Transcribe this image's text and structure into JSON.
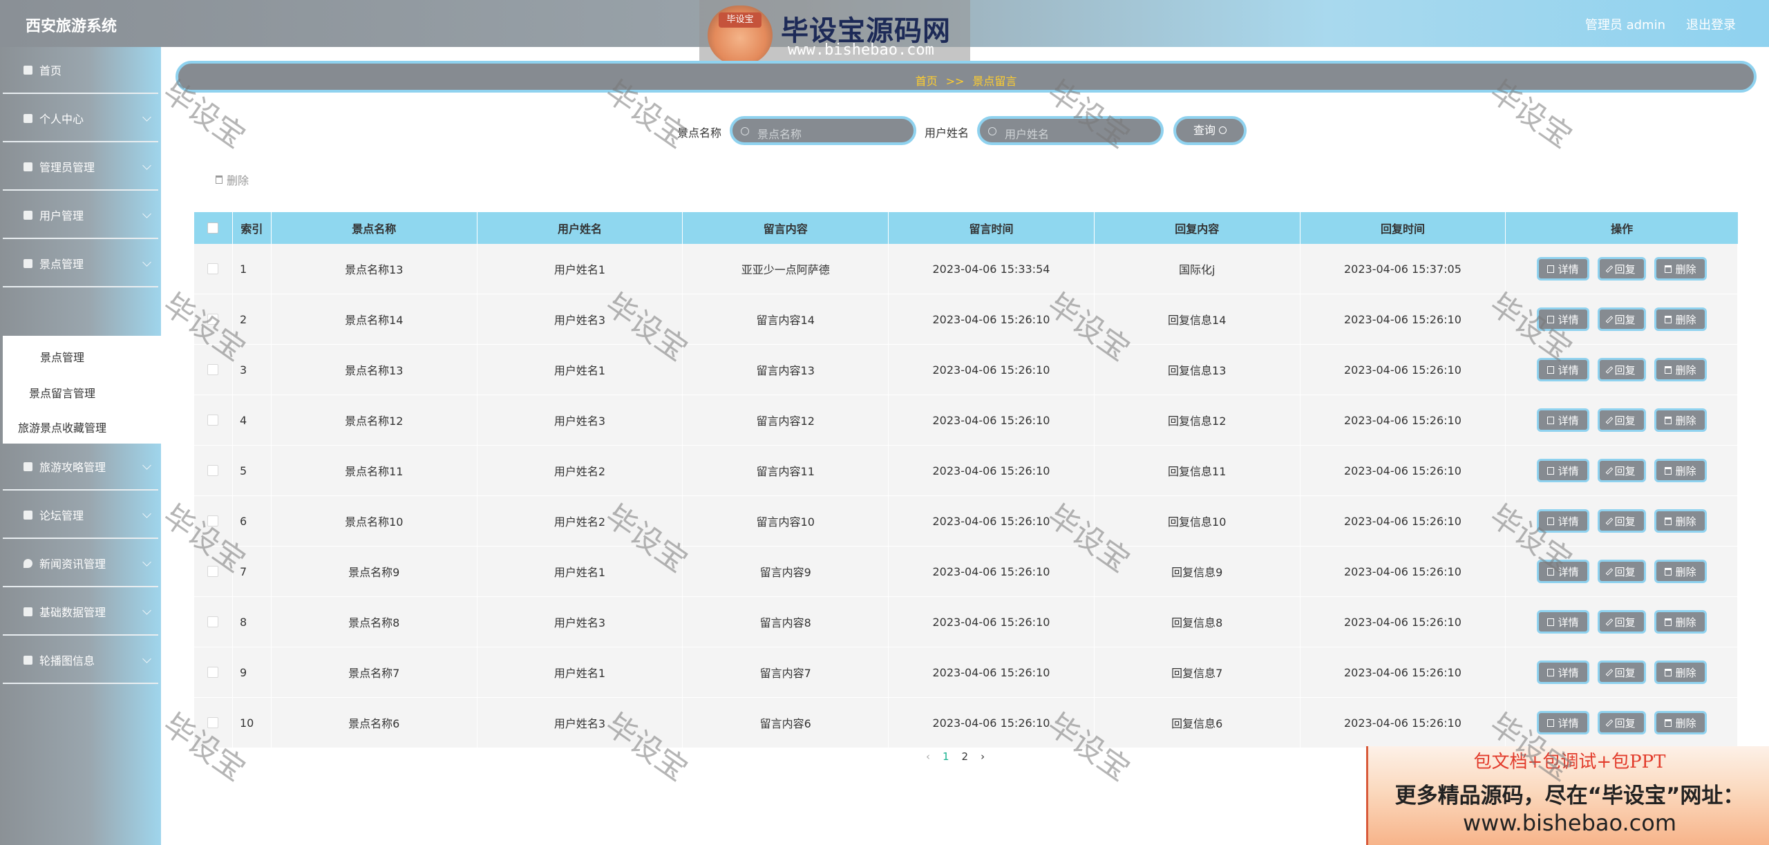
{
  "app": {
    "title": "西安旅游系统"
  },
  "header": {
    "user": "管理员 admin",
    "logout": "退出登录"
  },
  "logo": {
    "badge": "毕设宝",
    "name": "毕设宝源码网",
    "url": "www.bishebao.com"
  },
  "sidebar": {
    "items": [
      {
        "label": "首页",
        "icon": "home-icon"
      },
      {
        "label": "个人中心",
        "icon": "user-icon"
      },
      {
        "label": "管理员管理",
        "icon": "grid-icon"
      },
      {
        "label": "用户管理",
        "icon": "chat-icon"
      },
      {
        "label": "景点管理",
        "icon": "book-icon"
      },
      {
        "label": "旅游攻略管理",
        "icon": "grid-icon"
      },
      {
        "label": "论坛管理",
        "icon": "clipboard-icon"
      },
      {
        "label": "新闻资讯管理",
        "icon": "pin-icon"
      },
      {
        "label": "基础数据管理",
        "icon": "grid-icon"
      },
      {
        "label": "轮播图信息",
        "icon": "cup-icon"
      }
    ],
    "submenu": [
      "景点管理",
      "景点留言管理",
      "旅游景点收藏管理"
    ]
  },
  "breadcrumb": {
    "home": "首页",
    "sep": ">>",
    "current": "景点留言"
  },
  "search": {
    "field1_label": "景点名称",
    "field1_placeholder": "景点名称",
    "field2_label": "用户姓名",
    "field2_placeholder": "用户姓名",
    "button": "查询"
  },
  "toolbar": {
    "delete": "删除"
  },
  "table": {
    "headers": [
      "索引",
      "景点名称",
      "用户姓名",
      "留言内容",
      "留言时间",
      "回复内容",
      "回复时间",
      "操作"
    ],
    "actions": {
      "detail": "详情",
      "reply": "回复",
      "delete": "删除"
    },
    "rows": [
      {
        "index": "1",
        "spot": "景点名称13",
        "user": "用户姓名1",
        "content": "亚亚少一点阿萨德",
        "time": "2023-04-06 15:33:54",
        "reply": "国际化j",
        "reply_time": "2023-04-06 15:37:05"
      },
      {
        "index": "2",
        "spot": "景点名称14",
        "user": "用户姓名3",
        "content": "留言内容14",
        "time": "2023-04-06 15:26:10",
        "reply": "回复信息14",
        "reply_time": "2023-04-06 15:26:10"
      },
      {
        "index": "3",
        "spot": "景点名称13",
        "user": "用户姓名1",
        "content": "留言内容13",
        "time": "2023-04-06 15:26:10",
        "reply": "回复信息13",
        "reply_time": "2023-04-06 15:26:10"
      },
      {
        "index": "4",
        "spot": "景点名称12",
        "user": "用户姓名3",
        "content": "留言内容12",
        "time": "2023-04-06 15:26:10",
        "reply": "回复信息12",
        "reply_time": "2023-04-06 15:26:10"
      },
      {
        "index": "5",
        "spot": "景点名称11",
        "user": "用户姓名2",
        "content": "留言内容11",
        "time": "2023-04-06 15:26:10",
        "reply": "回复信息11",
        "reply_time": "2023-04-06 15:26:10"
      },
      {
        "index": "6",
        "spot": "景点名称10",
        "user": "用户姓名2",
        "content": "留言内容10",
        "time": "2023-04-06 15:26:10",
        "reply": "回复信息10",
        "reply_time": "2023-04-06 15:26:10"
      },
      {
        "index": "7",
        "spot": "景点名称9",
        "user": "用户姓名1",
        "content": "留言内容9",
        "time": "2023-04-06 15:26:10",
        "reply": "回复信息9",
        "reply_time": "2023-04-06 15:26:10"
      },
      {
        "index": "8",
        "spot": "景点名称8",
        "user": "用户姓名3",
        "content": "留言内容8",
        "time": "2023-04-06 15:26:10",
        "reply": "回复信息8",
        "reply_time": "2023-04-06 15:26:10"
      },
      {
        "index": "9",
        "spot": "景点名称7",
        "user": "用户姓名1",
        "content": "留言内容7",
        "time": "2023-04-06 15:26:10",
        "reply": "回复信息7",
        "reply_time": "2023-04-06 15:26:10"
      },
      {
        "index": "10",
        "spot": "景点名称6",
        "user": "用户姓名3",
        "content": "留言内容6",
        "time": "2023-04-06 15:26:10",
        "reply": "回复信息6",
        "reply_time": "2023-04-06 15:26:10"
      }
    ]
  },
  "pagination": {
    "pages": [
      "1",
      "2"
    ],
    "current": "1"
  },
  "ad": {
    "line1": "包文档+包调试+包PPT",
    "line2": "更多精品源码，尽在“毕设宝”网址：",
    "line3": "www.bishebao.com"
  },
  "watermark": {
    "text": "毕设宝"
  },
  "colors": {
    "accent": "#8fd2ef",
    "gray": "#868b91",
    "crumb": "#ffce2e",
    "pager_active": "#19b28f"
  }
}
